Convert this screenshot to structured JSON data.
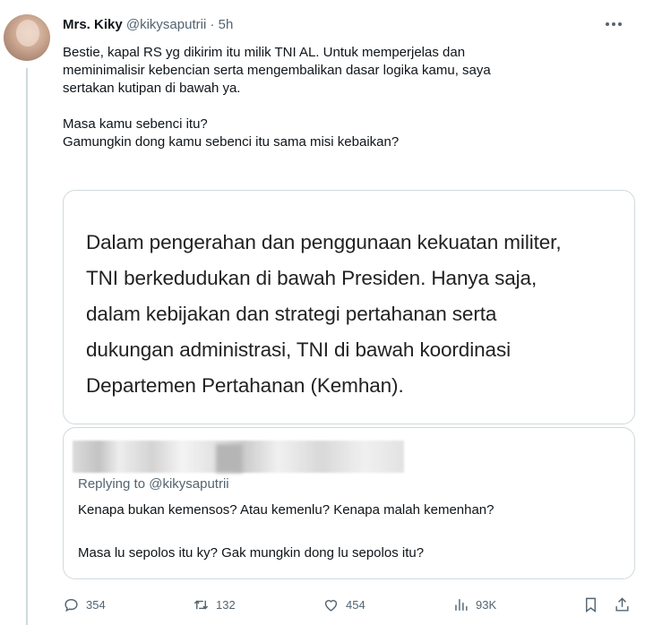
{
  "tweet": {
    "display_name": "Mrs. Kiky",
    "handle": "@kikysaputrii",
    "separator": "·",
    "time": "5h",
    "text_lines": [
      "Bestie, kapal RS yg dikirim itu milik TNI AL. Untuk memperjelas dan",
      "meminimalisir kebencian serta mengembalikan dasar logika kamu, saya",
      "sertakan kutipan di bawah ya."
    ],
    "text_lines_2": [
      "Masa kamu sebenci itu?",
      "Gamungkin dong kamu sebenci itu sama misi kebaikan?"
    ]
  },
  "quote_image": {
    "lines": [
      "Dalam pengerahan dan penggunaan kekuatan militer,",
      "TNI berkedudukan di bawah Presiden. Hanya saja,",
      "dalam kebijakan dan strategi pertahanan serta",
      "dukungan administrasi, TNI di bawah koordinasi",
      "Departemen Pertahanan (Kemhan)."
    ]
  },
  "quoted_tweet": {
    "replying_to": "Replying to @kikysaputrii",
    "line1": "Kenapa bukan kemensos? Atau kemenlu? Kenapa malah kemenhan?",
    "line2": "Masa lu sepolos itu ky? Gak mungkin dong lu sepolos itu?"
  },
  "actions": {
    "replies": "354",
    "retweets": "132",
    "likes": "454",
    "views": "93K"
  },
  "icons": {
    "reply": "reply-icon",
    "retweet": "retweet-icon",
    "like": "heart-icon",
    "views": "views-icon",
    "bookmark": "bookmark-icon",
    "share": "share-icon",
    "more": "more-icon"
  }
}
